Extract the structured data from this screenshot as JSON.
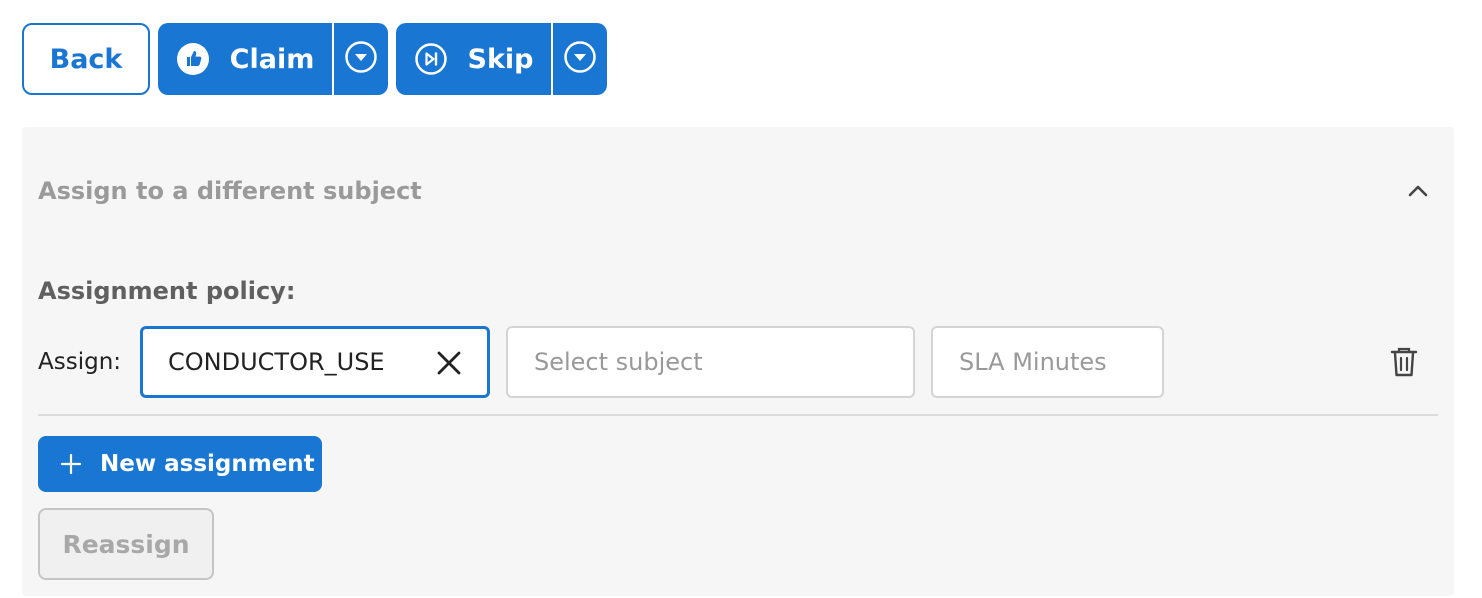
{
  "toolbar": {
    "back_label": "Back",
    "claim_label": "Claim",
    "skip_label": "Skip"
  },
  "panel": {
    "title": "Assign to a different subject",
    "policy_label": "Assignment policy:",
    "assign_label": "Assign:",
    "assignee_value": "CONDUCTOR_USE",
    "subject_placeholder": "Select subject",
    "sla_placeholder": "SLA Minutes",
    "new_assignment_label": "New assignment",
    "reassign_label": "Reassign"
  },
  "colors": {
    "primary": "#1976d2",
    "panel_bg": "#f6f6f6",
    "disabled": "#a8a8a8"
  },
  "icons": {
    "claim": "thumbs-up-icon",
    "skip": "skip-forward-icon",
    "dropdown": "chevron-down-circle-icon",
    "collapse": "chevron-up-icon",
    "clear": "close-icon",
    "delete": "trash-icon",
    "add": "plus-icon"
  }
}
